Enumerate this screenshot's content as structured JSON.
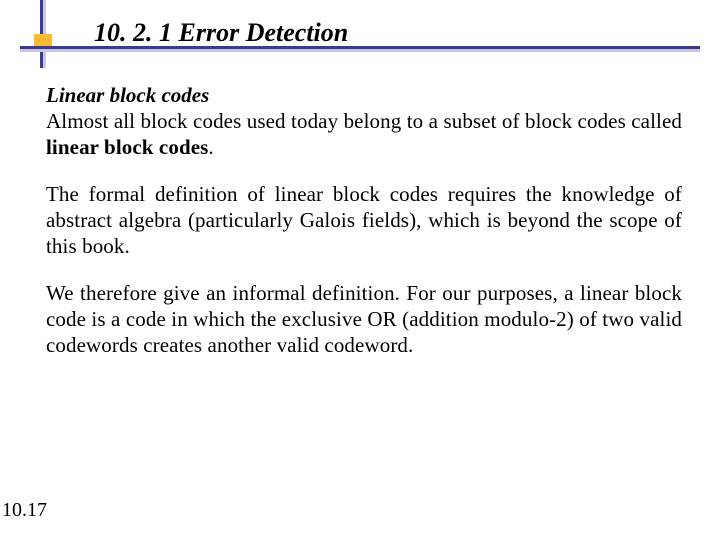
{
  "title": "10. 2. 1 Error Detection",
  "subheading": "Linear block codes",
  "p1": {
    "a": "Almost all block codes used today belong to a subset of block codes called ",
    "bold": "linear block codes",
    "b": "."
  },
  "p2": "The formal definition of linear block codes requires the knowledge of abstract algebra (particularly Galois fields), which is beyond the scope of this book.",
  "p3": "We therefore give an informal definition. For our purposes, a linear block code is a code in which the exclusive OR (addition modulo-2) of two valid codewords creates another valid codeword.",
  "page": "10.17"
}
